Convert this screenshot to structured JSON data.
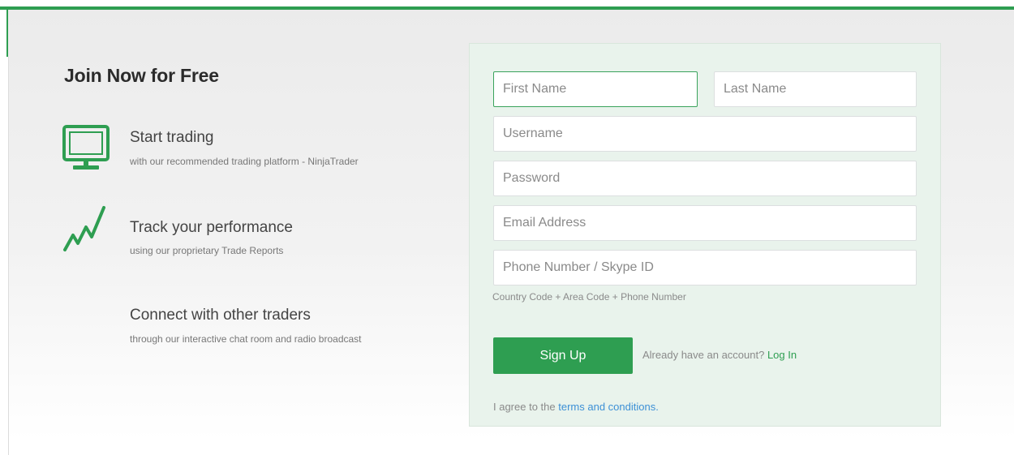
{
  "hero": {
    "title": "Join Now for Free"
  },
  "features": [
    {
      "icon": "monitor-icon",
      "title": "Start trading",
      "subtitle": "with our recommended trading platform - NinjaTrader"
    },
    {
      "icon": "trend-line-icon",
      "title": "Track your performance",
      "subtitle": "using our proprietary Trade Reports"
    },
    {
      "icon": "chat-icon",
      "title": "Connect with other traders",
      "subtitle": "through our interactive chat room and radio broadcast"
    }
  ],
  "form": {
    "first_name": {
      "placeholder": "First Name",
      "value": ""
    },
    "last_name": {
      "placeholder": "Last Name",
      "value": ""
    },
    "username": {
      "placeholder": "Username",
      "value": ""
    },
    "password": {
      "placeholder": "Password",
      "value": ""
    },
    "email": {
      "placeholder": "Email Address",
      "value": ""
    },
    "phone": {
      "placeholder": "Phone Number / Skype ID",
      "value": ""
    },
    "phone_hint": "Country Code + Area Code + Phone Number",
    "signup_label": "Sign Up",
    "login_prompt": "Already have an account?",
    "login_link": "Log In",
    "agree_prefix": "I agree to the",
    "terms_link": "terms and conditions."
  },
  "colors": {
    "accent": "#2e9e51",
    "link": "#3d90d6",
    "form_background": "#e9f3ec"
  }
}
